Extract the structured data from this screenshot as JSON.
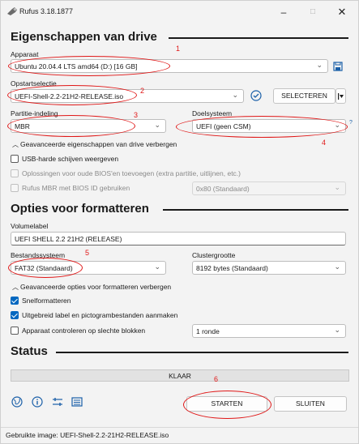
{
  "window": {
    "title": "Rufus 3.18.1877",
    "minimize": "–",
    "maximize": "□",
    "close": "✕"
  },
  "drive": {
    "heading": "Eigenschappen van drive",
    "device_label": "Apparaat",
    "device_value": "Ubuntu 20.04.4 LTS amd64 (D:) [16 GB]",
    "boot_label": "Opstartselectie",
    "boot_value": "UEFI-Shell-2.2-21H2-RELEASE.iso",
    "select_button": "SELECTEREN",
    "partition_label": "Partitie-indeling",
    "partition_value": "MBR",
    "target_label": "Doelsysteem",
    "target_value": "UEFI (geen CSM)",
    "target_help": "?",
    "advanced_toggle": "Geavanceerde eigenschappen van drive verbergen",
    "usb_hdd": "USB-harde schijven weergeven",
    "old_bios": "Oplossingen voor oude BIOS'en toevoegen (extra partitie, uitlijnen, etc.)",
    "rufus_mbr": "Rufus MBR met BIOS ID gebruiken",
    "bios_id_value": "0x80 (Standaard)"
  },
  "format": {
    "heading": "Opties voor formatteren",
    "volume_label": "Volumelabel",
    "volume_value": "UEFI SHELL 2.2 21H2 (RELEASE)",
    "fs_label": "Bestandssysteem",
    "fs_value": "FAT32 (Standaard)",
    "cluster_label": "Clustergrootte",
    "cluster_value": "8192 bytes (Standaard)",
    "advanced_toggle": "Geavanceerde opties voor formatteren verbergen",
    "quick_format": "Snelformatteren",
    "extended_label": "Uitgebreid label en pictogrambestanden aanmaken",
    "check_bad_blocks": "Apparaat controleren op slechte blokken",
    "passes_value": "1 ronde"
  },
  "status": {
    "heading": "Status",
    "progress_text": "KLAAR",
    "progress_fraction": 0,
    "start_button": "STARTEN",
    "close_button": "SLUITEN"
  },
  "footer": {
    "text": "Gebruikte image: UEFI-Shell-2.2-21H2-RELEASE.iso"
  },
  "annotations": [
    "1",
    "2",
    "3",
    "4",
    "5",
    "6"
  ],
  "colors": {
    "annotation": "#e01818",
    "accent": "#0067c0"
  }
}
